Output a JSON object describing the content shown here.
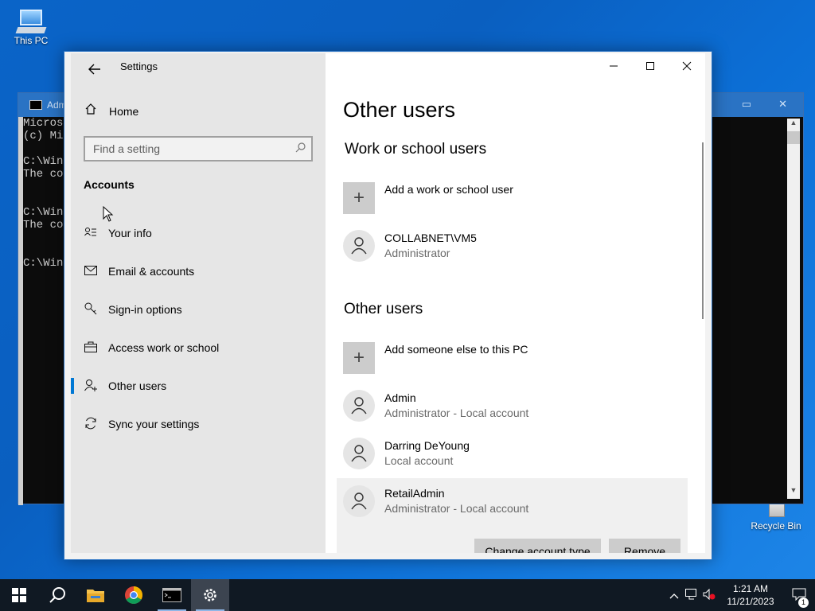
{
  "desktop": {
    "icons": [
      {
        "label": "This PC"
      },
      {
        "label": "Recycle Bin"
      }
    ]
  },
  "cmd_window": {
    "title": "Adm",
    "lines": "Microso\n(c) Mic\n\nC:\\Wind\nThe con\n\n\nC:\\Wind\nThe con\n\n\nC:\\Wind"
  },
  "settings": {
    "app_title": "Settings",
    "nav": {
      "home_label": "Home",
      "search_placeholder": "Find a setting",
      "section": "Accounts",
      "items": [
        {
          "label": "Your info",
          "icon": "person-card-icon"
        },
        {
          "label": "Email & accounts",
          "icon": "mail-icon"
        },
        {
          "label": "Sign-in options",
          "icon": "key-icon"
        },
        {
          "label": "Access work or school",
          "icon": "briefcase-icon"
        },
        {
          "label": "Other users",
          "icon": "person-add-icon",
          "selected": true
        },
        {
          "label": "Sync your settings",
          "icon": "sync-icon"
        }
      ]
    },
    "content": {
      "title": "Other users",
      "work_section": {
        "heading": "Work or school users",
        "add_label": "Add a work or school user",
        "users": [
          {
            "name": "COLLABNET\\VM5",
            "role": "Administrator"
          }
        ]
      },
      "other_section": {
        "heading": "Other users",
        "add_label": "Add someone else to this PC",
        "users": [
          {
            "name": "Admin",
            "role": "Administrator - Local account"
          },
          {
            "name": "Darring DeYoung",
            "role": "Local account"
          },
          {
            "name": "RetailAdmin",
            "role": "Administrator - Local account",
            "selected": true
          }
        ]
      },
      "buttons": {
        "change_type": "Change account type",
        "remove": "Remove"
      }
    }
  },
  "taskbar": {
    "clock_time": "1:21 AM",
    "clock_date": "11/21/2023",
    "notification_count": "1"
  }
}
